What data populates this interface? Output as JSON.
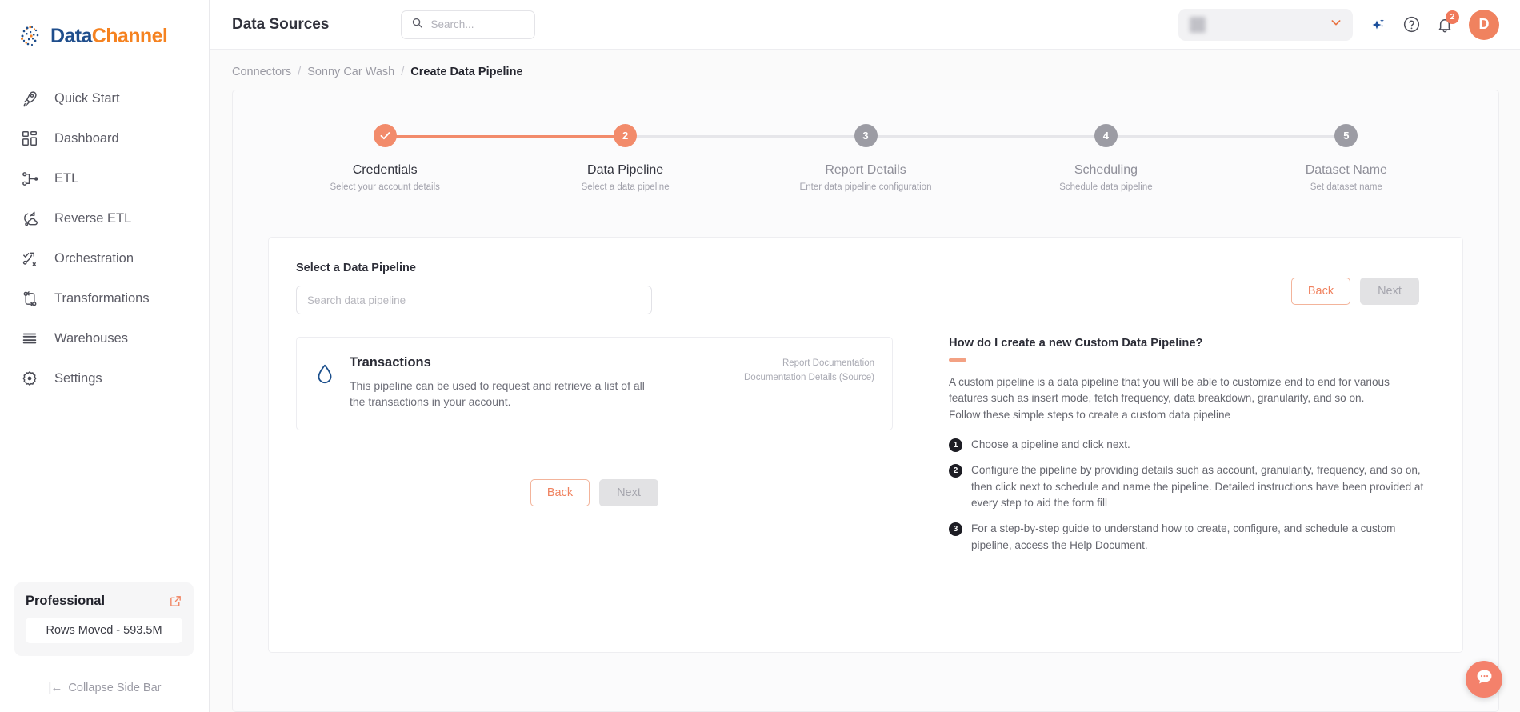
{
  "brand": {
    "name_part1": "Data",
    "name_part2": "Channel",
    "accent_orange": "#f28b6b",
    "logo_navy": "#1f4e8c",
    "logo_orange": "#f58220"
  },
  "sidebar": {
    "items": [
      {
        "label": "Quick Start",
        "icon": "rocket-icon"
      },
      {
        "label": "Dashboard",
        "icon": "grid-icon"
      },
      {
        "label": "ETL",
        "icon": "etl-flow-icon"
      },
      {
        "label": "Reverse ETL",
        "icon": "reverse-etl-cloud-icon"
      },
      {
        "label": "Orchestration",
        "icon": "orchestration-nodes-icon"
      },
      {
        "label": "Transformations",
        "icon": "transformations-loop-icon"
      },
      {
        "label": "Warehouses",
        "icon": "warehouse-stack-icon"
      },
      {
        "label": "Settings",
        "icon": "gear-icon"
      }
    ],
    "plan": {
      "name": "Professional",
      "rows_moved": "Rows Moved - 593.5M",
      "external_icon": "external-link-icon"
    },
    "collapse": {
      "glyph": "|←",
      "label": "Collapse Side Bar"
    }
  },
  "header": {
    "title": "Data Sources",
    "search_placeholder": "Search...",
    "search_value": "",
    "org_name": "",
    "notifications_count": "2",
    "avatar_initial": "D",
    "icons": {
      "search": "search-icon",
      "ai_sparkle": "sparkle-icon",
      "help": "help-circle-icon",
      "bell": "bell-icon",
      "caret": "chevron-down-icon"
    }
  },
  "breadcrumb": {
    "items": [
      "Connectors",
      "Sonny Car Wash",
      "Create Data Pipeline"
    ],
    "separator": "/"
  },
  "stepper": {
    "steps": [
      {
        "number": "✓",
        "title": "Credentials",
        "subtitle": "Select your account details",
        "state": "done"
      },
      {
        "number": "2",
        "title": "Data Pipeline",
        "subtitle": "Select a data pipeline",
        "state": "active"
      },
      {
        "number": "3",
        "title": "Report Details",
        "subtitle": "Enter data pipeline configuration",
        "state": "todo"
      },
      {
        "number": "4",
        "title": "Scheduling",
        "subtitle": "Schedule data pipeline",
        "state": "todo"
      },
      {
        "number": "5",
        "title": "Dataset Name",
        "subtitle": "Set dataset name",
        "state": "todo"
      }
    ]
  },
  "form": {
    "section_label": "Select a Data Pipeline",
    "search_placeholder": "Search data pipeline",
    "search_value": "",
    "back_label": "Back",
    "next_label": "Next"
  },
  "pipelines": [
    {
      "name": "Transactions",
      "description": "This pipeline can be used to request and retrieve a list of all the transactions in your account.",
      "icon": "water-drop-icon",
      "link_report": "Report Documentation",
      "link_details": "Documentation Details (Source)"
    }
  ],
  "help": {
    "title": "How do I create a new Custom Data Pipeline?",
    "paragraph1": "A custom pipeline is a data pipeline that you will be able to customize end to end for various features such as insert mode, fetch frequency, data breakdown, granularity, and so on.",
    "paragraph2": "Follow these simple steps to create a custom data pipeline",
    "steps": [
      {
        "num": "1",
        "text": "Choose a pipeline and click next."
      },
      {
        "num": "2",
        "text": "Configure the pipeline by providing details such as account, granularity, frequency, and so on, then click next to schedule and name the pipeline. Detailed instructions have been provided at every step to aid the form fill"
      },
      {
        "num": "3",
        "text": "For a step-by-step guide to understand how to create, configure, and schedule a custom pipeline, access the Help Document."
      }
    ]
  },
  "chat": {
    "icon": "chat-bubble-icon"
  }
}
